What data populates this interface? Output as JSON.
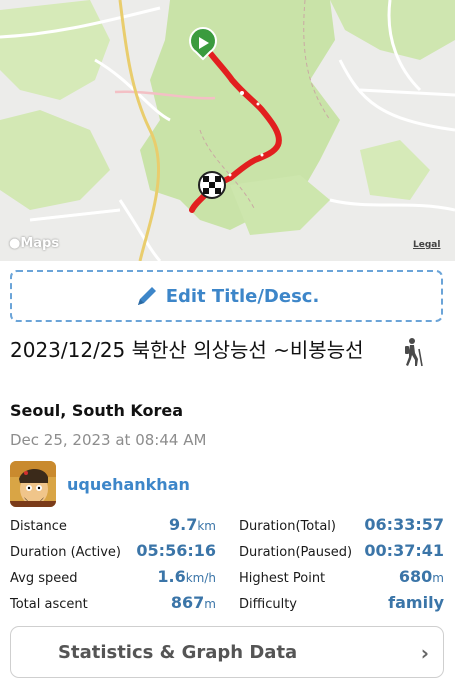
{
  "map": {
    "provider_label": "Maps",
    "legal_label": "Legal",
    "start_icon": "play-icon",
    "finish_icon": "checkered-flag-icon",
    "route_color": "#e21f1f"
  },
  "edit_button": {
    "icon": "pencil-icon",
    "label": "Edit Title/Desc."
  },
  "activity": {
    "title": "2023/12/25 북한산 의상능선 ~비봉능선",
    "type_icon": "hiker-icon",
    "location": "Seoul, South Korea",
    "date": "Dec 25, 2023 at 08:44 AM"
  },
  "user": {
    "name": "uquehankhan",
    "avatar_icon": "avatar-icon"
  },
  "stats": {
    "distance": {
      "label": "Distance",
      "value": "9.7",
      "unit": "km"
    },
    "duration_total": {
      "label": "Duration(Total)",
      "value": "06:33:57"
    },
    "duration_active": {
      "label": "Duration (Active)",
      "value": "05:56:16"
    },
    "duration_paused": {
      "label": "Duration(Paused)",
      "value": "00:37:41"
    },
    "avg_speed": {
      "label": "Avg speed",
      "value": "1.6",
      "unit": "km/h"
    },
    "highest_point": {
      "label": "Highest Point",
      "value": "680",
      "unit": "m"
    },
    "total_ascent": {
      "label": "Total ascent",
      "value": "867",
      "unit": "m"
    },
    "difficulty": {
      "label": "Difficulty",
      "value": "family"
    }
  },
  "stats_button": {
    "label": "Statistics & Graph Data",
    "icon": "chevron-right-icon"
  },
  "colors": {
    "accent": "#3d86c9",
    "value_blue": "#3b75a8",
    "map_green": "#c9e3a8"
  }
}
